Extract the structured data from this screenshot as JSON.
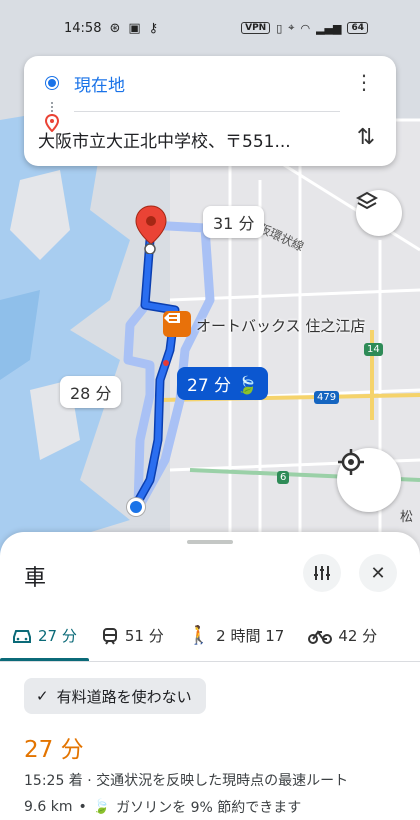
{
  "status_bar": {
    "time": "14:58",
    "vpn": "VPN",
    "battery": "64"
  },
  "search": {
    "origin": "現在地",
    "destination": "大阪市立大正北中学校、〒551...",
    "more_icon": "more-vert-icon",
    "swap_icon": "swap-vert-icon"
  },
  "map": {
    "callout_alt1": "31 分",
    "callout_main": "27 分",
    "callout_alt2": "28 分",
    "poi_label": "オートバックス 住之江店",
    "road_label": "大阪環状線",
    "shield_14": "14",
    "shield_479": "479",
    "shield_6": "6",
    "place_partial": "松",
    "route_color": "#1a5fd6",
    "alt_route_color": "#a9c1f5"
  },
  "sheet": {
    "mode_title": "車",
    "tabs": [
      {
        "label": "27 分",
        "icon": "car-icon"
      },
      {
        "label": "51 分",
        "icon": "train-icon"
      },
      {
        "label": "2 時間 17",
        "icon": "walk-icon"
      },
      {
        "label": "42 分",
        "icon": "bicycle-icon"
      }
    ],
    "chip_label": "有料道路を使わない",
    "duration": "27 分",
    "detail_line1": "15:25 着 · 交通状況を反映した現時点の最速ルート",
    "detail_distance": "9.6 km",
    "detail_fuel": "ガソリンを 9% 節約できます"
  }
}
